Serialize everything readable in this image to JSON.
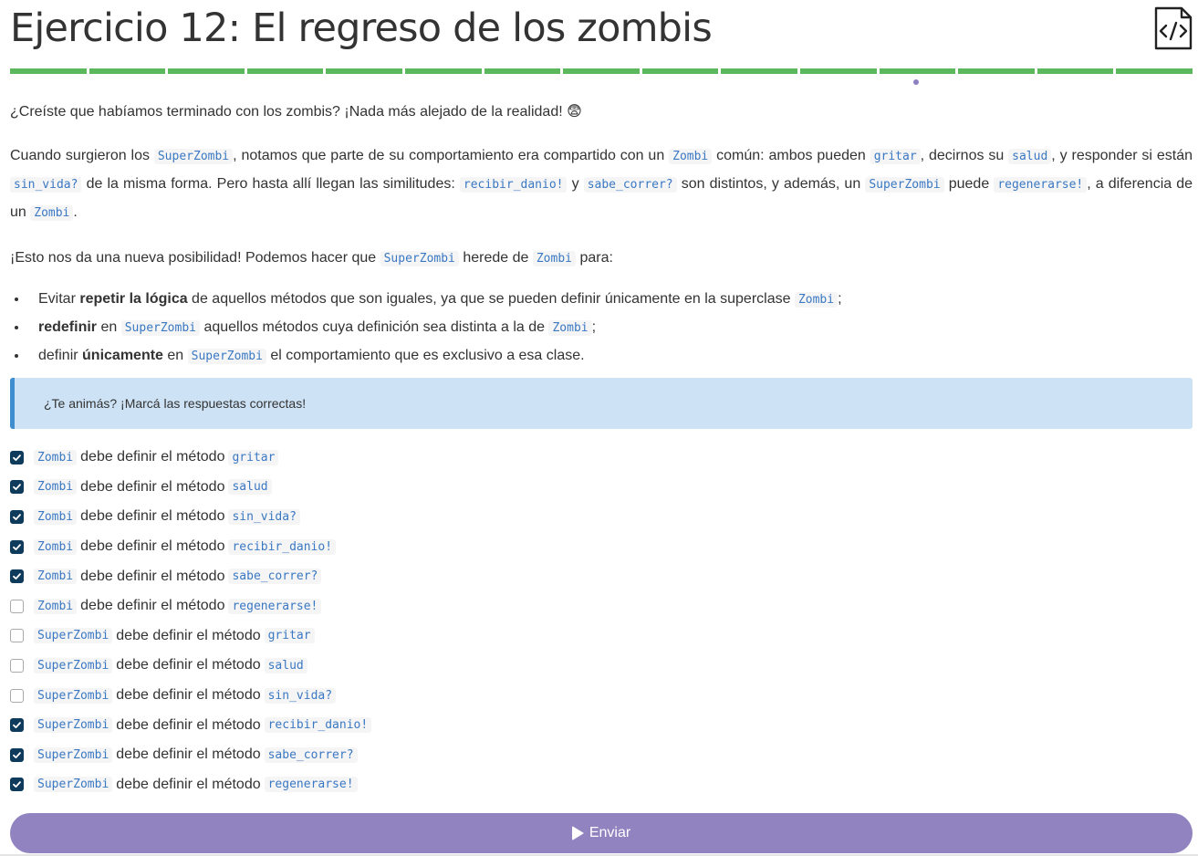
{
  "title": "Ejercicio 12: El regreso de los zombis",
  "progress_segments": 15,
  "progress_current": 11,
  "intro": {
    "p1_text": "¿Creíste que habíamos terminado con los zombis? ¡Nada más alejado de la realidad!",
    "p1_emoji": "😨",
    "p2": {
      "t1": "Cuando surgieron los",
      "c1": "SuperZombi",
      "t2": ", notamos que parte de su comportamiento era compartido con un",
      "c2": "Zombi",
      "t3": "común: ambos pueden",
      "c3": "gritar",
      "t4": ", decirnos su",
      "c4": "salud",
      "t5": ", y responder si están",
      "c5": "sin_vida?",
      "t6": "de la misma forma. Pero hasta allí llegan las similitudes:",
      "c6": "recibir_danio!",
      "t7": "y",
      "c7": "sabe_correr?",
      "t8": "son distintos, y además, un",
      "c8": "SuperZombi",
      "t9": "puede",
      "c9": "regenerarse!",
      "t10": ", a diferencia de un",
      "c10": "Zombi",
      "t11": "."
    },
    "p3": {
      "t1": "¡Esto nos da una nueva posibilidad! Podemos hacer que",
      "c1": "SuperZombi",
      "t2": "herede de",
      "c2": "Zombi",
      "t3": "para:"
    },
    "bullets": [
      {
        "pre": "Evitar ",
        "bold": "repetir la lógica",
        "mid": " de aquellos métodos que son iguales, ya que se pueden definir únicamente en la superclase",
        "code": "Zombi",
        "post": ";"
      },
      {
        "pre": "",
        "bold": "redefinir",
        "mid": " en",
        "code": "SuperZombi",
        "post": "aquellos métodos cuya definición sea distinta a la de",
        "code2": "Zombi",
        "post2": ";"
      },
      {
        "pre": "definir ",
        "bold": "únicamente",
        "mid": " en",
        "code": "SuperZombi",
        "post": "el comportamiento que es exclusivo a esa clase."
      }
    ]
  },
  "callout": "¿Te animás? ¡Marcá las respuestas correctas!",
  "options": [
    {
      "owner": "Zombi",
      "text": "debe definir el método",
      "method": "gritar",
      "checked": true
    },
    {
      "owner": "Zombi",
      "text": "debe definir el método",
      "method": "salud",
      "checked": true
    },
    {
      "owner": "Zombi",
      "text": "debe definir el método",
      "method": "sin_vida?",
      "checked": true
    },
    {
      "owner": "Zombi",
      "text": "debe definir el método",
      "method": "recibir_danio!",
      "checked": true
    },
    {
      "owner": "Zombi",
      "text": "debe definir el método",
      "method": "sabe_correr?",
      "checked": true
    },
    {
      "owner": "Zombi",
      "text": "debe definir el método",
      "method": "regenerarse!",
      "checked": false
    },
    {
      "owner": "SuperZombi",
      "text": "debe definir el método",
      "method": "gritar",
      "checked": false
    },
    {
      "owner": "SuperZombi",
      "text": "debe definir el método",
      "method": "salud",
      "checked": false
    },
    {
      "owner": "SuperZombi",
      "text": "debe definir el método",
      "method": "sin_vida?",
      "checked": false
    },
    {
      "owner": "SuperZombi",
      "text": "debe definir el método",
      "method": "recibir_danio!",
      "checked": true
    },
    {
      "owner": "SuperZombi",
      "text": "debe definir el método",
      "method": "sabe_correr?",
      "checked": true
    },
    {
      "owner": "SuperZombi",
      "text": "debe definir el método",
      "method": "regenerarse!",
      "checked": true
    }
  ],
  "submit_label": "Enviar",
  "colors": {
    "progress": "#5cb85c",
    "accent": "#9183bf",
    "checkbox": "#0e3a5b",
    "code": "#3a78c3",
    "callout_bg": "#cde2f4",
    "callout_border": "#3e8ed0"
  }
}
